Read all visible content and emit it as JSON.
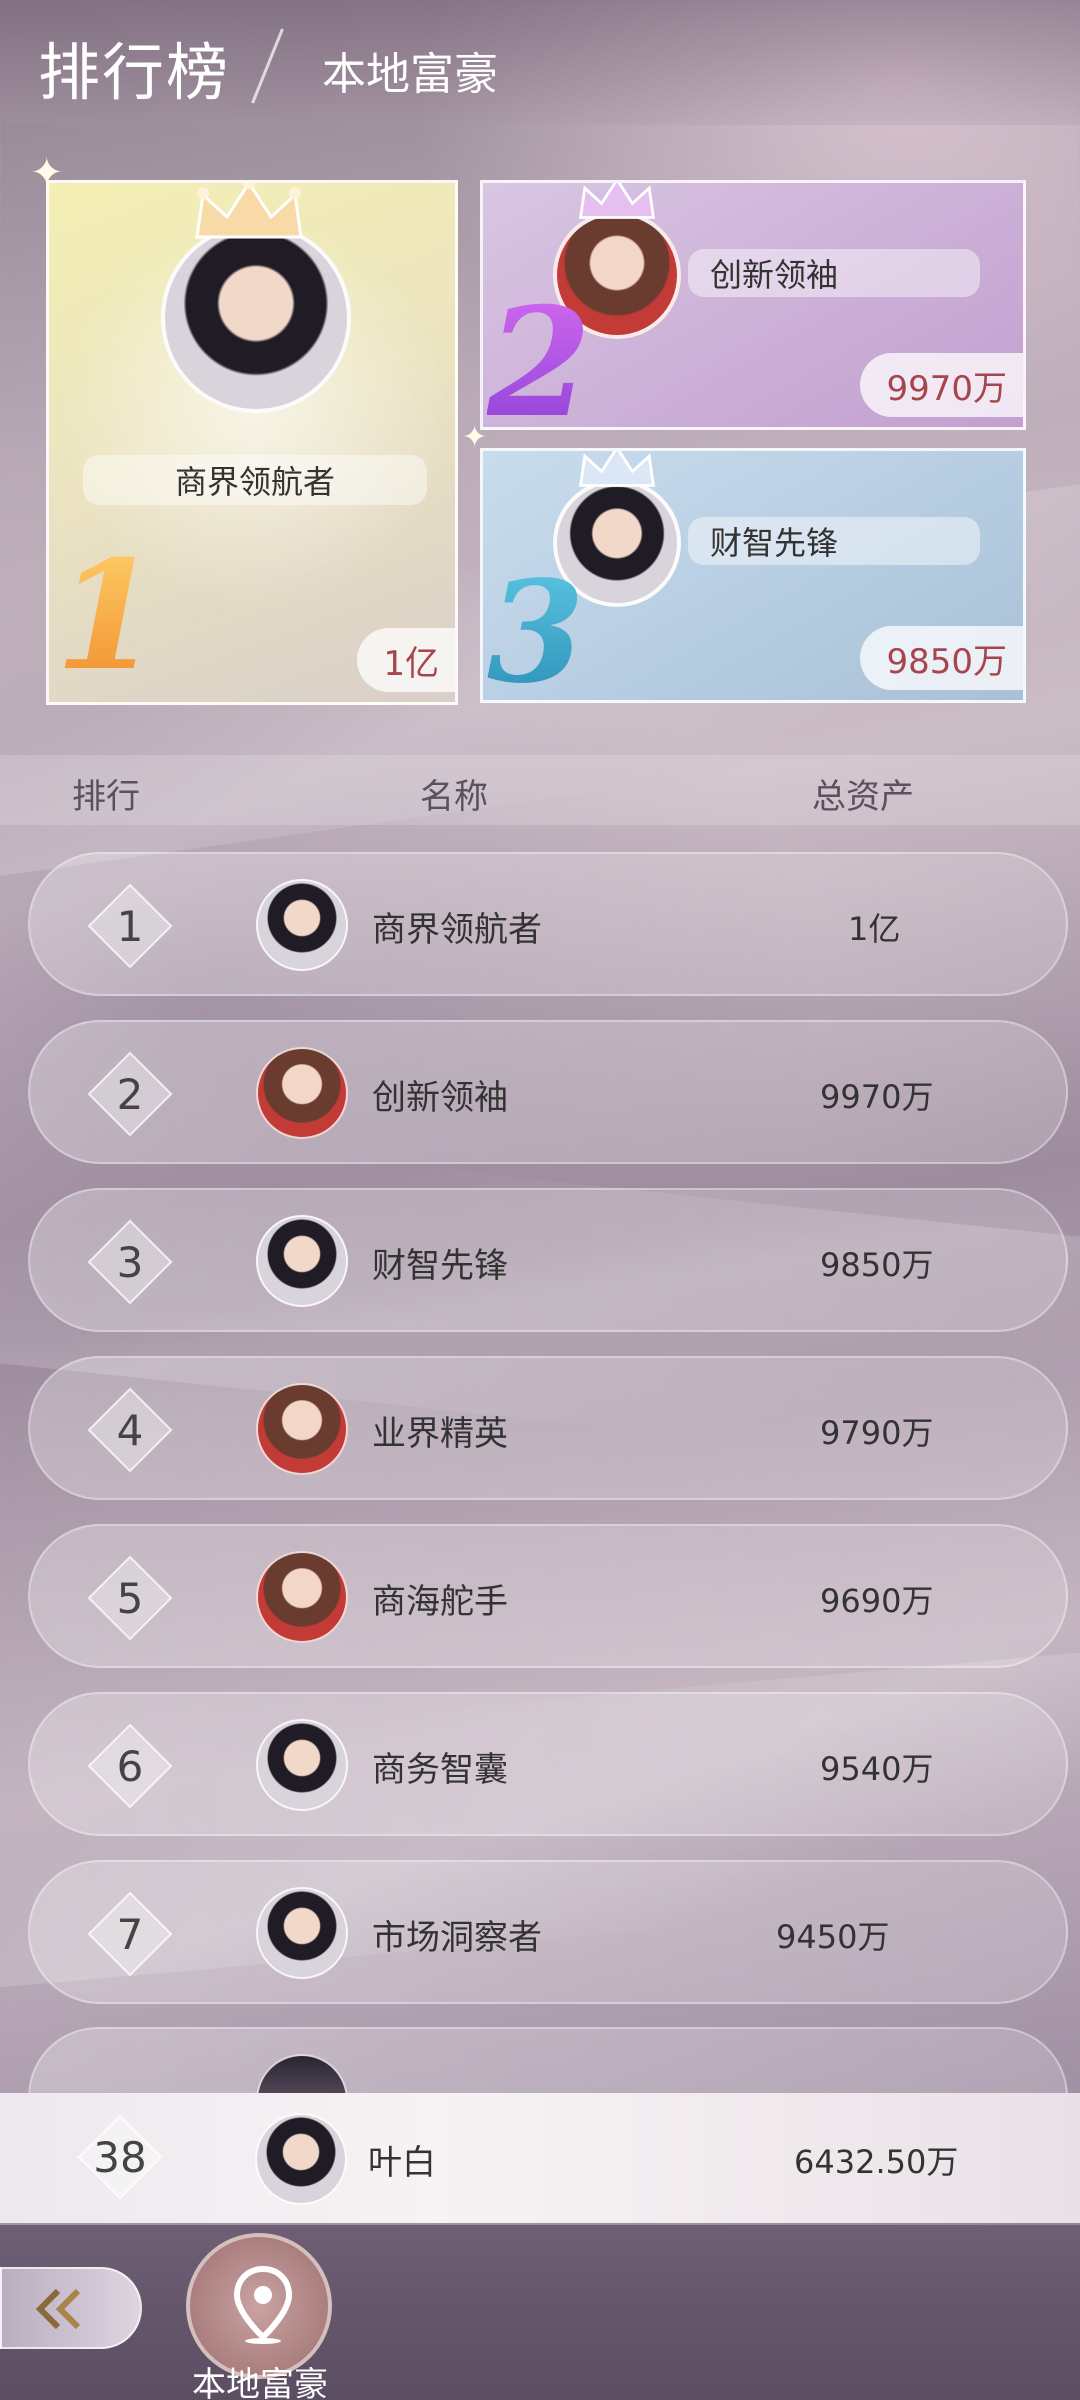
{
  "header": {
    "title": "排行榜",
    "subtitle": "本地富豪"
  },
  "podium": [
    {
      "rank": "1",
      "name": "商界领航者",
      "value": "1亿",
      "gender": "m"
    },
    {
      "rank": "2",
      "name": "创新领袖",
      "value": "9970万",
      "gender": "f"
    },
    {
      "rank": "3",
      "name": "财智先锋",
      "value": "9850万",
      "gender": "m"
    }
  ],
  "table": {
    "col_rank": "排行",
    "col_name": "名称",
    "col_assets": "总资产"
  },
  "rows": [
    {
      "rank": "1",
      "name": "商界领航者",
      "value": "1亿",
      "gender": "m"
    },
    {
      "rank": "2",
      "name": "创新领袖",
      "value": "9970万",
      "gender": "f"
    },
    {
      "rank": "3",
      "name": "财智先锋",
      "value": "9850万",
      "gender": "m"
    },
    {
      "rank": "4",
      "name": "业界精英",
      "value": "9790万",
      "gender": "f"
    },
    {
      "rank": "5",
      "name": "商海舵手",
      "value": "9690万",
      "gender": "f"
    },
    {
      "rank": "6",
      "name": "商务智囊",
      "value": "9540万",
      "gender": "m"
    },
    {
      "rank": "7",
      "name": "市场洞察者",
      "value": "9450万",
      "gender": "m"
    }
  ],
  "my_rank": {
    "rank": "38",
    "name": "叶白",
    "value": "6432.50万"
  },
  "bottom": {
    "back_icon": "double-chevron-left-icon",
    "location_icon": "map-pin-icon",
    "location_label": "本地富豪"
  }
}
